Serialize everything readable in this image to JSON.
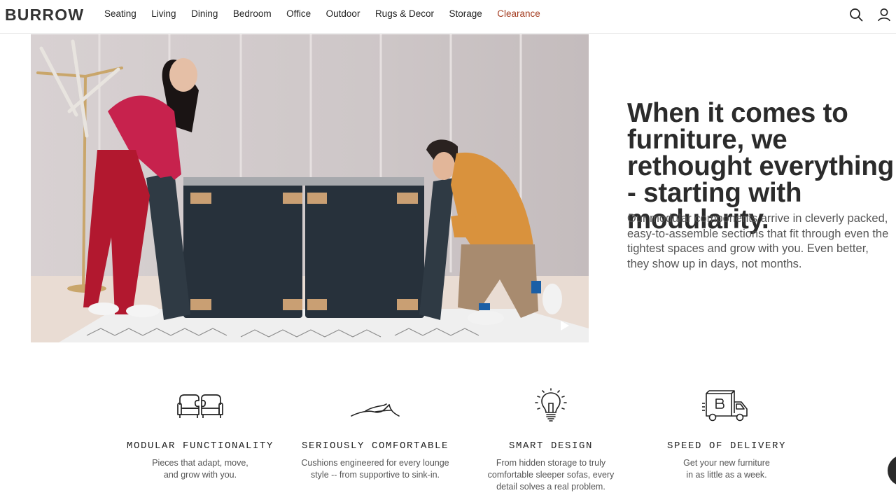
{
  "header": {
    "logo": "BURROW",
    "nav": [
      "Seating",
      "Living",
      "Dining",
      "Bedroom",
      "Office",
      "Outdoor",
      "Rugs & Decor",
      "Storage",
      "Clearance"
    ],
    "icons": [
      "search-icon",
      "account-icon"
    ],
    "clearance_color": "#a33a1e"
  },
  "hero": {
    "headline": "When it comes to furniture, we rethought everything - starting with modularity.",
    "body": "Our modular components arrive in cleverly packed, easy-to-assemble sections that fit through even the tightest spaces and grow with you. Even better, they show up in days, not months.",
    "video_control": "play-icon"
  },
  "features": [
    {
      "icon": "modular-sofa-icon",
      "title": "MODULAR FUNCTIONALITY",
      "desc": [
        "Pieces that adapt, move,",
        "and grow with you."
      ]
    },
    {
      "icon": "hand-on-cushion-icon",
      "title": "SERIOUSLY COMFORTABLE",
      "desc": [
        "Cushions engineered for every lounge",
        "style -- from supportive to sink-in."
      ]
    },
    {
      "icon": "lightbulb-icon",
      "title": "SMART DESIGN",
      "desc": [
        "From hidden storage to truly",
        "comfortable sleeper sofas, every",
        "detail solves a real problem."
      ]
    },
    {
      "icon": "delivery-truck-icon",
      "title": "SPEED OF DELIVERY",
      "desc": [
        "Get your new furniture",
        "in as little as a week."
      ]
    }
  ]
}
